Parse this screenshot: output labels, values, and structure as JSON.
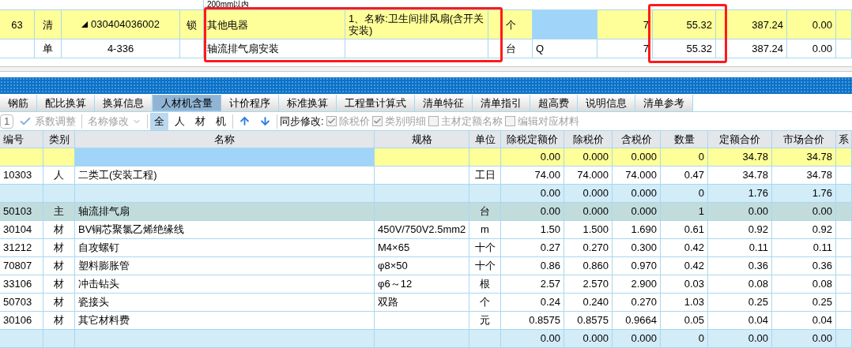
{
  "upper_table": {
    "partial_row": {
      "name": "200mm以内"
    },
    "rows": [
      {
        "selected": true,
        "number": "63",
        "type": "清",
        "expanded": true,
        "code": "030404036002",
        "lock": "锁",
        "name": "其他电器",
        "feature": "1、名称:卫生间排风扇(含开关安装)",
        "unit": "个",
        "quantity": "7",
        "unit_price": "55.32",
        "total": "387.24",
        "column_13": "0.00"
      },
      {
        "selected": false,
        "type": "单",
        "code": "4-336",
        "name": "轴流排气扇安装",
        "unit": "台",
        "spec": "Q",
        "quantity": "7",
        "unit_price": "55.32",
        "total": "387.24",
        "column_13": "0.00"
      }
    ]
  },
  "tabs": [
    {
      "label": "钢筋",
      "selected": false
    },
    {
      "label": "配比换算",
      "selected": false
    },
    {
      "label": "换算信息",
      "selected": false
    },
    {
      "label": "人材机含量",
      "selected": true
    },
    {
      "label": "计价程序",
      "selected": false
    },
    {
      "label": "标准换算",
      "selected": false
    },
    {
      "label": "工程量计算式",
      "selected": false
    },
    {
      "label": "清单特征",
      "selected": false
    },
    {
      "label": "清单指引",
      "selected": false
    },
    {
      "label": "超高费",
      "selected": false
    },
    {
      "label": "说明信息",
      "selected": false
    },
    {
      "label": "清单参考",
      "selected": false
    }
  ],
  "toolbar": {
    "count_field": "1",
    "coefficient_button": {
      "label": "系数调整",
      "disabled": true
    },
    "rename_button": {
      "label": "名称修改",
      "disabled": true
    },
    "filters": [
      {
        "label": "全",
        "selected": true
      },
      {
        "label": "人",
        "selected": false
      },
      {
        "label": "材",
        "selected": false
      },
      {
        "label": "机",
        "selected": false
      }
    ],
    "sync_label": "同步修改:",
    "options": [
      {
        "label": "除税价",
        "checked": true,
        "disabled": true
      },
      {
        "label": "类别明细",
        "checked": true,
        "disabled": true
      },
      {
        "label": "主材定额名称",
        "checked": false,
        "disabled": true
      },
      {
        "label": "编辑对应材料",
        "checked": false,
        "disabled": true
      }
    ]
  },
  "resource_table": {
    "columns": [
      "编号",
      "类别",
      "名称",
      "规格",
      "单位",
      "除税定额价",
      "除税价",
      "含税价",
      "数量",
      "定额合价",
      "市场合价",
      "系"
    ],
    "rows": [
      {
        "kind": "summary",
        "selected": true,
        "cells": [
          "",
          "",
          "",
          "",
          "",
          "0.00",
          "0.000",
          "0.000",
          "0",
          "34.78",
          "34.78"
        ]
      },
      {
        "kind": "labor",
        "selected": false,
        "cells": [
          "10303",
          "人",
          "二类工(安装工程)",
          "",
          "工日",
          "74.00",
          "74.000",
          "74.000",
          "0.47",
          "34.78",
          "34.78"
        ]
      },
      {
        "kind": "subtotal",
        "selected": false,
        "cells": [
          "",
          "",
          "",
          "",
          "",
          "0.00",
          "0.000",
          "0.000",
          "0",
          "1.76",
          "1.76"
        ]
      },
      {
        "kind": "main",
        "selected": false,
        "cells": [
          "50103",
          "主",
          "轴流排气扇",
          "",
          "台",
          "0.00",
          "0.000",
          "0.000",
          "1",
          "0.00",
          "0.00"
        ]
      },
      {
        "kind": "material",
        "selected": false,
        "cells": [
          "30104",
          "材",
          "BV铜芯聚氯乙烯绝缘线",
          "450V/750V2.5mm2",
          "m",
          "1.50",
          "1.500",
          "1.690",
          "0.61",
          "0.92",
          "0.92"
        ]
      },
      {
        "kind": "material",
        "selected": false,
        "cells": [
          "31212",
          "材",
          "自攻螺钉",
          "M4×65",
          "十个",
          "0.27",
          "0.270",
          "0.300",
          "0.42",
          "0.11",
          "0.11"
        ]
      },
      {
        "kind": "material",
        "selected": false,
        "cells": [
          "70807",
          "材",
          "塑料膨胀管",
          "φ8×50",
          "十个",
          "0.86",
          "0.860",
          "0.970",
          "0.42",
          "0.36",
          "0.36"
        ]
      },
      {
        "kind": "material",
        "selected": false,
        "cells": [
          "33106",
          "材",
          "冲击钻头",
          "φ6～12",
          "根",
          "2.57",
          "2.570",
          "2.900",
          "0.03",
          "0.08",
          "0.08"
        ]
      },
      {
        "kind": "material",
        "selected": false,
        "cells": [
          "50703",
          "材",
          "瓷接头",
          "双路",
          "个",
          "0.24",
          "0.240",
          "0.270",
          "1.03",
          "0.25",
          "0.25"
        ]
      },
      {
        "kind": "material",
        "selected": false,
        "cells": [
          "30106",
          "材",
          "其它材料费",
          "",
          "元",
          "0.8575",
          "0.8575",
          "0.9664",
          "0.05",
          "0.04",
          "0.04"
        ]
      },
      {
        "kind": "subtotal",
        "selected": false,
        "cells": [
          "",
          "",
          "",
          "",
          "",
          "0.00",
          "0.000",
          "0.000",
          "0",
          "0.00",
          "0.00"
        ]
      }
    ]
  }
}
